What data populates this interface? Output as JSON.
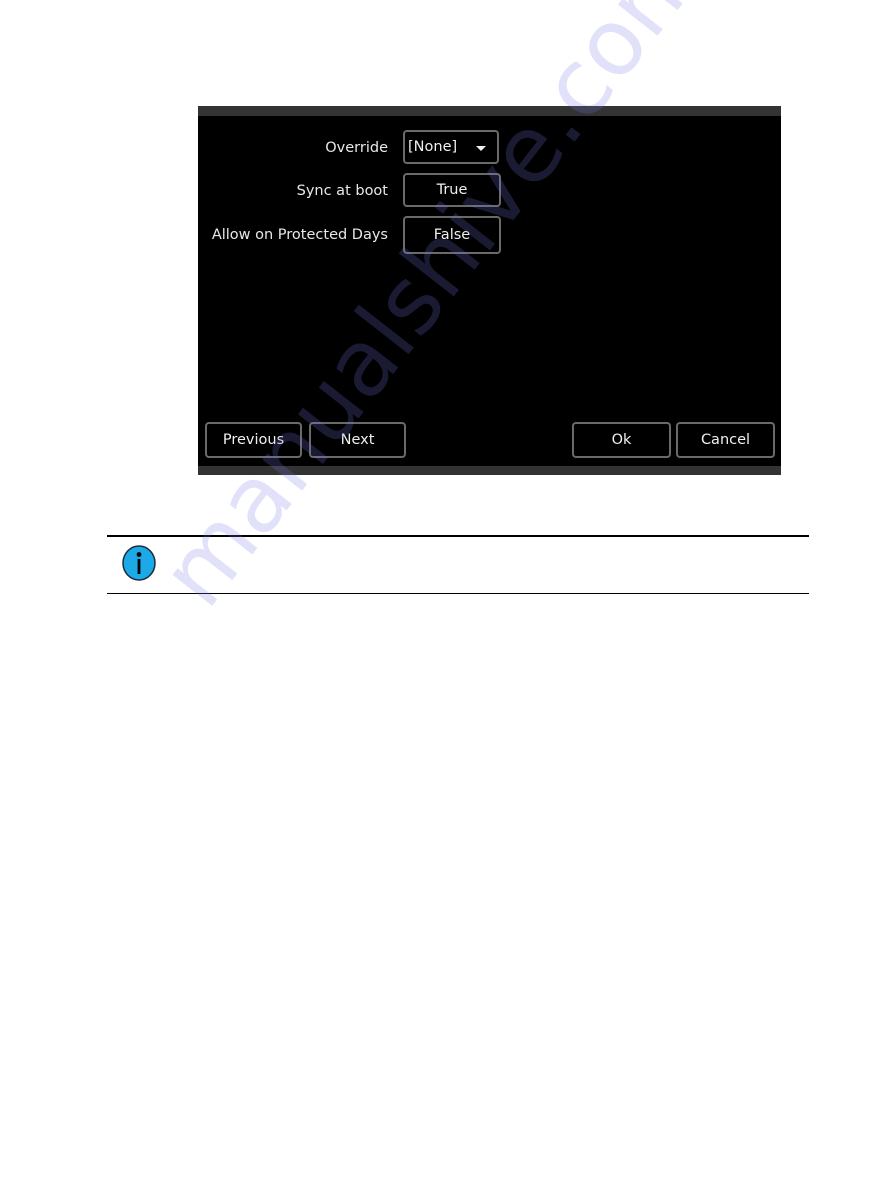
{
  "dialog": {
    "fields": [
      {
        "label": "Override",
        "value": "[None]",
        "type": "dropdown"
      },
      {
        "label": "Sync at boot",
        "value": "True",
        "type": "toggle"
      },
      {
        "label": "Allow on Protected Days",
        "value": "False",
        "type": "toggle"
      }
    ],
    "buttons": {
      "previous": "Previous",
      "next": "Next",
      "ok": "Ok",
      "cancel": "Cancel"
    }
  },
  "note": {
    "icon": "info-icon",
    "icon_color": "#1BA9E8",
    "text": ""
  },
  "watermark": "manualshive.com"
}
